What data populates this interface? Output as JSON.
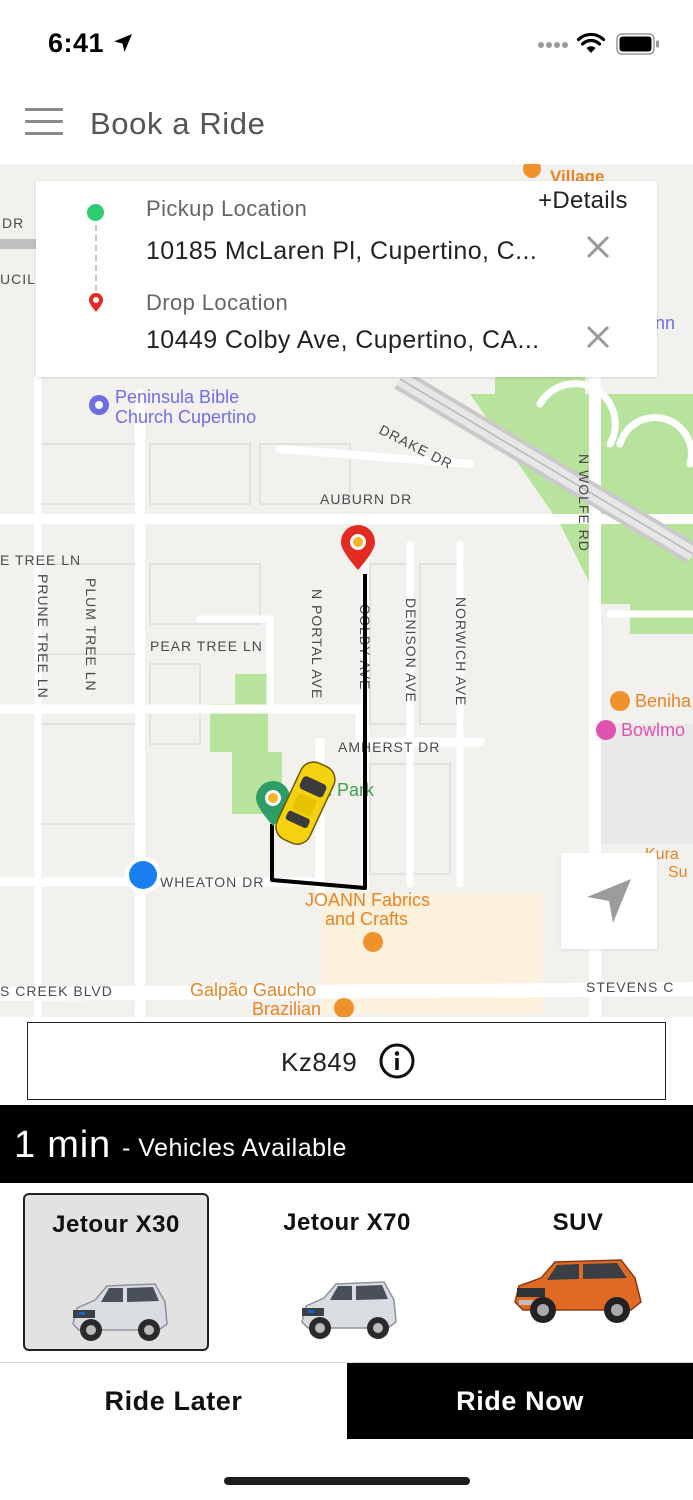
{
  "status_bar": {
    "time": "6:41"
  },
  "header": {
    "title": "Book a Ride",
    "menu_icon": "hamburger-menu-icon"
  },
  "location_card": {
    "pickup_label": "Pickup Location",
    "pickup_value": "10185 McLaren Pl, Cupertino, C...",
    "drop_label": "Drop Location",
    "drop_value": "10449 Colby Ave, Cupertino, CA...",
    "details_link": "+Details",
    "pickup_color": "#2ecc71",
    "drop_color": "#e32b22"
  },
  "map": {
    "labels": {
      "village": "Village",
      "dr": "DR",
      "ucil": "UCIL",
      "church_line1": "Peninsula Bible",
      "church_line2": "Church Cupertino",
      "drake": "DRAKE DR",
      "auburn": "AUBURN DR",
      "tree_ln": "E TREE LN",
      "prune": "PRUNE TREE LN",
      "plum": "PLUM TREE LN",
      "pear": "PEAR TREE LN",
      "portal": "N PORTAL AVE",
      "colby": "COLBY AVE",
      "denison": "DENISON AVE",
      "norwich": "NORWICH AVE",
      "wolfe": "N WOLFE RD",
      "amherst": "AMHERST DR",
      "park": "al Park",
      "wheaton": "WHEATON DR",
      "joann1": "JOANN Fabrics",
      "joann2": "and Crafts",
      "creek": "S CREEK BLVD",
      "galpao1": "Galpão Gaucho",
      "galpao2": "Brazilian",
      "stevens": "STEVENS C",
      "beniha": "Beniha",
      "bowlmo": "Bowlmo",
      "kura1": "Kura",
      "kura2": "Su",
      "nn": "nn"
    },
    "colors": {
      "land": "#f2f1ee",
      "road": "#ffffff",
      "green": "#b8e39c",
      "route": "#000000",
      "user_dot": "#1a7ff0",
      "poi_orange": "#f0922b",
      "poi_purple": "#6e6ee8"
    }
  },
  "code_box": {
    "code": "Kz849",
    "info_icon": "info-circle-icon"
  },
  "availability": {
    "eta": "1 min",
    "text": "- Vehicles Available"
  },
  "vehicles": [
    {
      "name": "Jetour X30",
      "selected": true,
      "color": "#dfe3e8"
    },
    {
      "name": "Jetour X70",
      "selected": false,
      "color": "#dfe3e8"
    },
    {
      "name": "SUV",
      "selected": false,
      "color": "#e06a24"
    }
  ],
  "actions": {
    "ride_later": "Ride Later",
    "ride_now": "Ride Now"
  }
}
